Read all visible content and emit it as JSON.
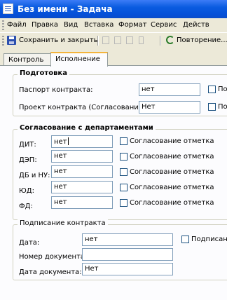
{
  "window": {
    "title": "Без имени - Задача"
  },
  "menu": [
    "Файл",
    "Правка",
    "Вид",
    "Вставка",
    "Формат",
    "Сервис",
    "Действ"
  ],
  "toolbar": {
    "save_close": "Сохранить и закрыть",
    "recurrence": "Повторение..."
  },
  "tabs": [
    "Контроль",
    "Исполнение"
  ],
  "prep": {
    "title": "Подготовка",
    "rows": [
      {
        "label": "Паспорт контракта:",
        "value": "нет",
        "check": "По"
      },
      {
        "label": "Проект контракта (Согласование):",
        "value": "Нет",
        "check": "По"
      }
    ]
  },
  "depts": {
    "title": "Согласование с департаментами",
    "rows": [
      {
        "label": "ДИТ:",
        "value": "нет",
        "check": "Согласование отметка"
      },
      {
        "label": "ДЭП:",
        "value": "нет",
        "check": "Согласование отметка"
      },
      {
        "label": "ДБ и НУ:",
        "value": "нет",
        "check": "Согласование отметка"
      },
      {
        "label": "ЮД:",
        "value": "нет",
        "check": "Согласование отметка"
      },
      {
        "label": "ФД:",
        "value": "нет",
        "check": "Согласование отметка"
      }
    ]
  },
  "signing": {
    "title": "Подписание контракта",
    "date_label": "Дата:",
    "date_value": "нет",
    "signed_check": "Подписан",
    "docnum_label": "Номер документа:",
    "docnum_value": "",
    "docdate_label": "Дата документа:",
    "docdate_value": "Нет"
  }
}
